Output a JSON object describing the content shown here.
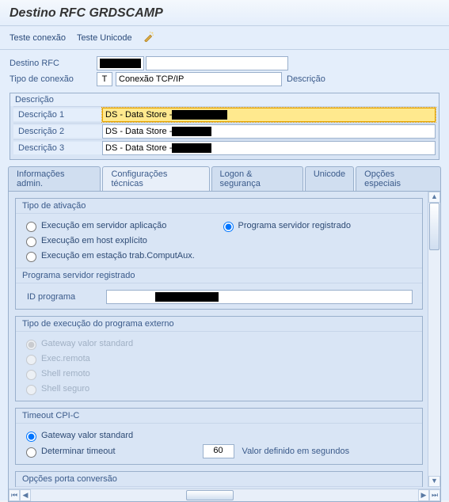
{
  "title": "Destino RFC GRDSCAMP",
  "toolbar": {
    "test_conn": "Teste conexão",
    "test_unicode": "Teste Unicode"
  },
  "header": {
    "rfc_label": "Destino RFC",
    "type_label": "Tipo de conexão",
    "type_code": "T",
    "type_text": "Conexão TCP/IP",
    "desc_label": "Descrição"
  },
  "desc_group": {
    "title": "Descrição",
    "rows": [
      {
        "label": "Descrição 1",
        "prefix": "DS - Data Store - "
      },
      {
        "label": "Descrição 2",
        "prefix": "DS - Data Store - "
      },
      {
        "label": "Descrição 3",
        "prefix": "DS - Data Store - "
      }
    ]
  },
  "tabs": {
    "admin": "Informações admin.",
    "tech": "Configurações técnicas",
    "logon": "Logon & segurança",
    "unicode": "Unicode",
    "special": "Opções especiais"
  },
  "activation": {
    "title": "Tipo de ativação",
    "opt_app": "Execução em servidor aplicação",
    "opt_reg": "Programa servidor registrado",
    "opt_host": "Execução em host explícito",
    "opt_ws": "Execução em estação trab.ComputAux."
  },
  "reg_prog": {
    "title": "Programa servidor registrado",
    "id_label": "ID programa"
  },
  "ext_exec": {
    "title": "Tipo de execução do programa externo",
    "gw_std": "Gateway valor standard",
    "remote": "Exec.remota",
    "rshell": "Shell remoto",
    "sshell": "Shell seguro"
  },
  "timeout": {
    "title": "Timeout CPI-C",
    "gw_std": "Gateway valor standard",
    "det": "Determinar timeout",
    "value": "60",
    "unit": "Valor definido em segundos"
  },
  "port_opts": {
    "title": "Opções porta conversão"
  }
}
